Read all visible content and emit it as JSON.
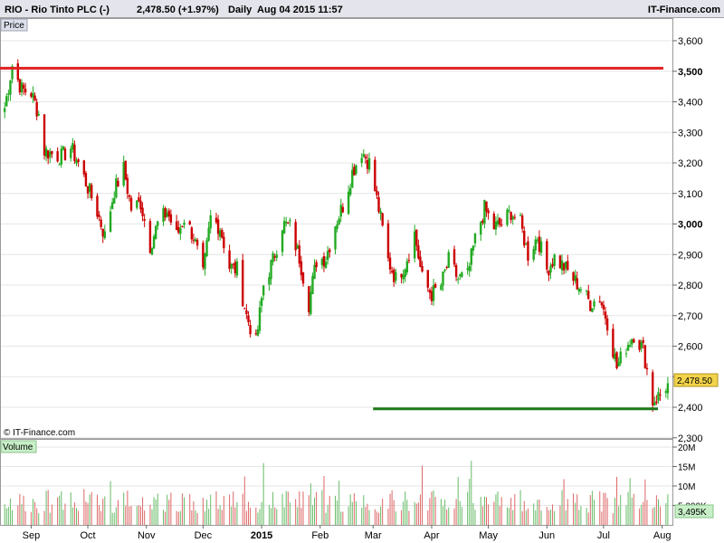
{
  "header": {
    "symbol": "RIO - Rio Tinto PLC (-)",
    "price": "2,478.50 (+1.97%)",
    "period": "Daily",
    "timestamp": "Aug 04 2015 11:57",
    "brand": "IT-Finance.com"
  },
  "price_panel_label": "Price",
  "volume_panel_label": "Volume",
  "copyright": "© IT-Finance.com",
  "last_price_label": "2,478.50",
  "last_volume_label": "3,495K",
  "colors": {
    "up": "#22aa22",
    "down": "#cc0000",
    "resistance": "#e02020",
    "support": "#1a7a1a",
    "price_tag": "#f2d34a",
    "volume_tag": "#c8f0c8"
  },
  "chart_data": [
    {
      "type": "candlestick",
      "title": "",
      "yaxis_ticks": [
        "3,600",
        "3,500",
        "3,400",
        "3,300",
        "3,200",
        "3,100",
        "3,000",
        "2,900",
        "2,800",
        "2,700",
        "2,600",
        "2,500",
        "2,400",
        "2,300"
      ],
      "bold_ticks": [
        "3,500",
        "3,000"
      ],
      "ylim": [
        2300,
        3600
      ],
      "xaxis_labels": [
        "Sep",
        "Oct",
        "Nov",
        "Dec",
        "2015",
        "Feb",
        "Mar",
        "Apr",
        "May",
        "Jun",
        "Jul",
        "Aug"
      ],
      "resistance_level": 3510,
      "support_level": 2395,
      "last_price": 2478.5,
      "series": [
        {
          "d": "2014-08-18",
          "c": 3380
        },
        {
          "d": "2014-08-22",
          "c": 3520
        },
        {
          "d": "2014-08-27",
          "c": 3440
        },
        {
          "d": "2014-09-01",
          "c": 3430
        },
        {
          "d": "2014-09-05",
          "c": 3360
        },
        {
          "d": "2014-09-08",
          "c": 3240
        },
        {
          "d": "2014-09-12",
          "c": 3230
        },
        {
          "d": "2014-09-17",
          "c": 3220
        },
        {
          "d": "2014-09-22",
          "c": 3250
        },
        {
          "d": "2014-09-26",
          "c": 3200
        },
        {
          "d": "2014-10-01",
          "c": 3120
        },
        {
          "d": "2014-10-06",
          "c": 3040
        },
        {
          "d": "2014-10-10",
          "c": 2960
        },
        {
          "d": "2014-10-15",
          "c": 3110
        },
        {
          "d": "2014-10-20",
          "c": 3180
        },
        {
          "d": "2014-10-24",
          "c": 3050
        },
        {
          "d": "2014-10-29",
          "c": 3070
        },
        {
          "d": "2014-11-03",
          "c": 2930
        },
        {
          "d": "2014-11-07",
          "c": 3000
        },
        {
          "d": "2014-11-12",
          "c": 3040
        },
        {
          "d": "2014-11-17",
          "c": 2960
        },
        {
          "d": "2014-11-21",
          "c": 3020
        },
        {
          "d": "2014-11-26",
          "c": 2960
        },
        {
          "d": "2014-12-01",
          "c": 2830
        },
        {
          "d": "2014-12-05",
          "c": 3020
        },
        {
          "d": "2014-12-10",
          "c": 2990
        },
        {
          "d": "2014-12-15",
          "c": 2860
        },
        {
          "d": "2014-12-19",
          "c": 2850
        },
        {
          "d": "2014-12-24",
          "c": 2700
        },
        {
          "d": "2014-12-29",
          "c": 2610
        },
        {
          "d": "2015-01-02",
          "c": 2800
        },
        {
          "d": "2015-01-07",
          "c": 2880
        },
        {
          "d": "2015-01-12",
          "c": 3000
        },
        {
          "d": "2015-01-16",
          "c": 2990
        },
        {
          "d": "2015-01-21",
          "c": 2890
        },
        {
          "d": "2015-01-26",
          "c": 2740
        },
        {
          "d": "2015-01-30",
          "c": 2880
        },
        {
          "d": "2015-02-04",
          "c": 2890
        },
        {
          "d": "2015-02-09",
          "c": 3000
        },
        {
          "d": "2015-02-13",
          "c": 3060
        },
        {
          "d": "2015-02-18",
          "c": 3170
        },
        {
          "d": "2015-02-23",
          "c": 3240
        },
        {
          "d": "2015-02-27",
          "c": 3200
        },
        {
          "d": "2015-03-04",
          "c": 3050
        },
        {
          "d": "2015-03-09",
          "c": 2880
        },
        {
          "d": "2015-03-13",
          "c": 2820
        },
        {
          "d": "2015-03-18",
          "c": 2870
        },
        {
          "d": "2015-03-23",
          "c": 2970
        },
        {
          "d": "2015-03-27",
          "c": 2820
        },
        {
          "d": "2015-04-01",
          "c": 2770
        },
        {
          "d": "2015-04-06",
          "c": 2800
        },
        {
          "d": "2015-04-10",
          "c": 2880
        },
        {
          "d": "2015-04-15",
          "c": 2820
        },
        {
          "d": "2015-04-20",
          "c": 2830
        },
        {
          "d": "2015-04-24",
          "c": 2950
        },
        {
          "d": "2015-04-29",
          "c": 3050
        },
        {
          "d": "2015-05-04",
          "c": 2990
        },
        {
          "d": "2015-05-08",
          "c": 3000
        },
        {
          "d": "2015-05-13",
          "c": 3040
        },
        {
          "d": "2015-05-18",
          "c": 3000
        },
        {
          "d": "2015-05-22",
          "c": 2900
        },
        {
          "d": "2015-05-27",
          "c": 2960
        },
        {
          "d": "2015-06-01",
          "c": 2850
        },
        {
          "d": "2015-06-05",
          "c": 2890
        },
        {
          "d": "2015-06-10",
          "c": 2860
        },
        {
          "d": "2015-06-15",
          "c": 2820
        },
        {
          "d": "2015-06-19",
          "c": 2790
        },
        {
          "d": "2015-06-24",
          "c": 2740
        },
        {
          "d": "2015-06-29",
          "c": 2760
        },
        {
          "d": "2015-07-03",
          "c": 2680
        },
        {
          "d": "2015-07-08",
          "c": 2530
        },
        {
          "d": "2015-07-13",
          "c": 2600
        },
        {
          "d": "2015-07-17",
          "c": 2640
        },
        {
          "d": "2015-07-22",
          "c": 2590
        },
        {
          "d": "2015-07-27",
          "c": 2420
        },
        {
          "d": "2015-07-31",
          "c": 2440
        },
        {
          "d": "2015-08-04",
          "c": 2478.5
        }
      ]
    },
    {
      "type": "bar",
      "title": "",
      "yaxis_ticks": [
        "20M",
        "15M",
        "10M",
        "5,000K"
      ],
      "ylim": [
        0,
        20000000
      ],
      "last_volume": 3495000
    }
  ]
}
